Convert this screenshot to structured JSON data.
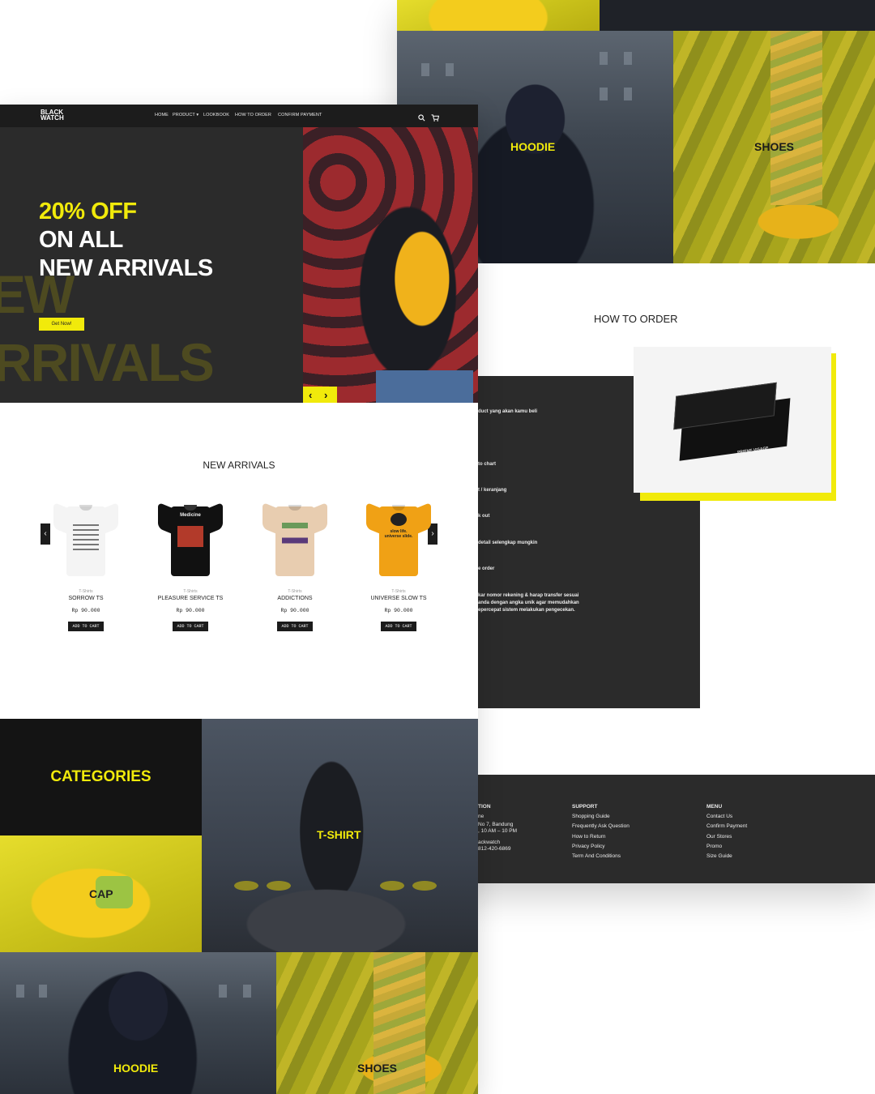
{
  "brand": {
    "line1": "BLACK",
    "line2": "WATCH"
  },
  "nav": {
    "items": [
      "HOME",
      "PRODUCT ▾",
      "LOOKBOOK",
      "HOW TO ORDER",
      "CONFIRM PAYMENT"
    ],
    "search_icon": "search-icon",
    "cart_icon": "cart-icon"
  },
  "hero": {
    "line1": "20% OFF",
    "line2": "ON ALL",
    "line3": "NEW ARRIVALS",
    "ghost1": "EW",
    "ghost2": "RRIVALS",
    "cta": "Get Now!",
    "prev_icon": "chevron-left-icon",
    "next_icon": "chevron-right-icon"
  },
  "new_arrivals": {
    "title": "NEW ARRIVALS",
    "products": [
      {
        "category": "T-Shirts",
        "name": "SORROW TS",
        "price": "Rp 90.000",
        "button": "ADD TO CART",
        "color": "#f4f4f4"
      },
      {
        "category": "T-Shirts",
        "name": "PLEASURE SERVICE TS",
        "price": "Rp 90.000",
        "button": "ADD TO CART",
        "color": "#111111"
      },
      {
        "category": "T-Shirts",
        "name": "ADDICTIONS",
        "price": "Rp 90.000",
        "button": "ADD TO CART",
        "color": "#e8cdb0"
      },
      {
        "category": "T-Shirts",
        "name": "UNIVERSE SLOW TS",
        "price": "Rp 90.000",
        "button": "ADD TO CART",
        "color": "#f0a115"
      }
    ],
    "print_texts": [
      "",
      "Medicine",
      "",
      "slow life. universe slide."
    ]
  },
  "categories": {
    "title": "CATEGORIES",
    "items": [
      "CAP",
      "T-SHIRT",
      "HOODIE",
      "SHOES"
    ]
  },
  "back_categories": [
    "HOODIE",
    "SHOES"
  ],
  "how_to_order": {
    "title": "HOW TO ORDER",
    "steps": [
      "duct yang akan kamu beli",
      "to chart",
      "t / keranjang",
      "k out",
      "detail selengkap mungkin",
      "e order",
      "kar nomor rekening & harap transfer sesuai",
      "anda dengan angka unik agar memudahkan",
      "epercepat sistem melakukan pengecekan."
    ],
    "box_brand": "PRIENE VISAGE"
  },
  "footer": {
    "info_title": "TION",
    "info_lines": [
      "ne",
      "No 7, Bandung",
      ", 10 AM – 10 PM",
      "",
      "ackwatch",
      "812-420-6869"
    ],
    "support_title": "SUPPORT",
    "support_links": [
      "Shopping Guide",
      "Frequently Ask Question",
      "How to Return",
      "Privacy Policy",
      "Term And Conditions"
    ],
    "menu_title": "MENU",
    "menu_links": [
      "Contact Us",
      "Confirm Payment",
      "Our Stores",
      "Promo",
      "Size Guide"
    ]
  },
  "colors": {
    "accent": "#f1ea0b",
    "dark": "#2b2b2b",
    "olive": "#4d4a20"
  }
}
